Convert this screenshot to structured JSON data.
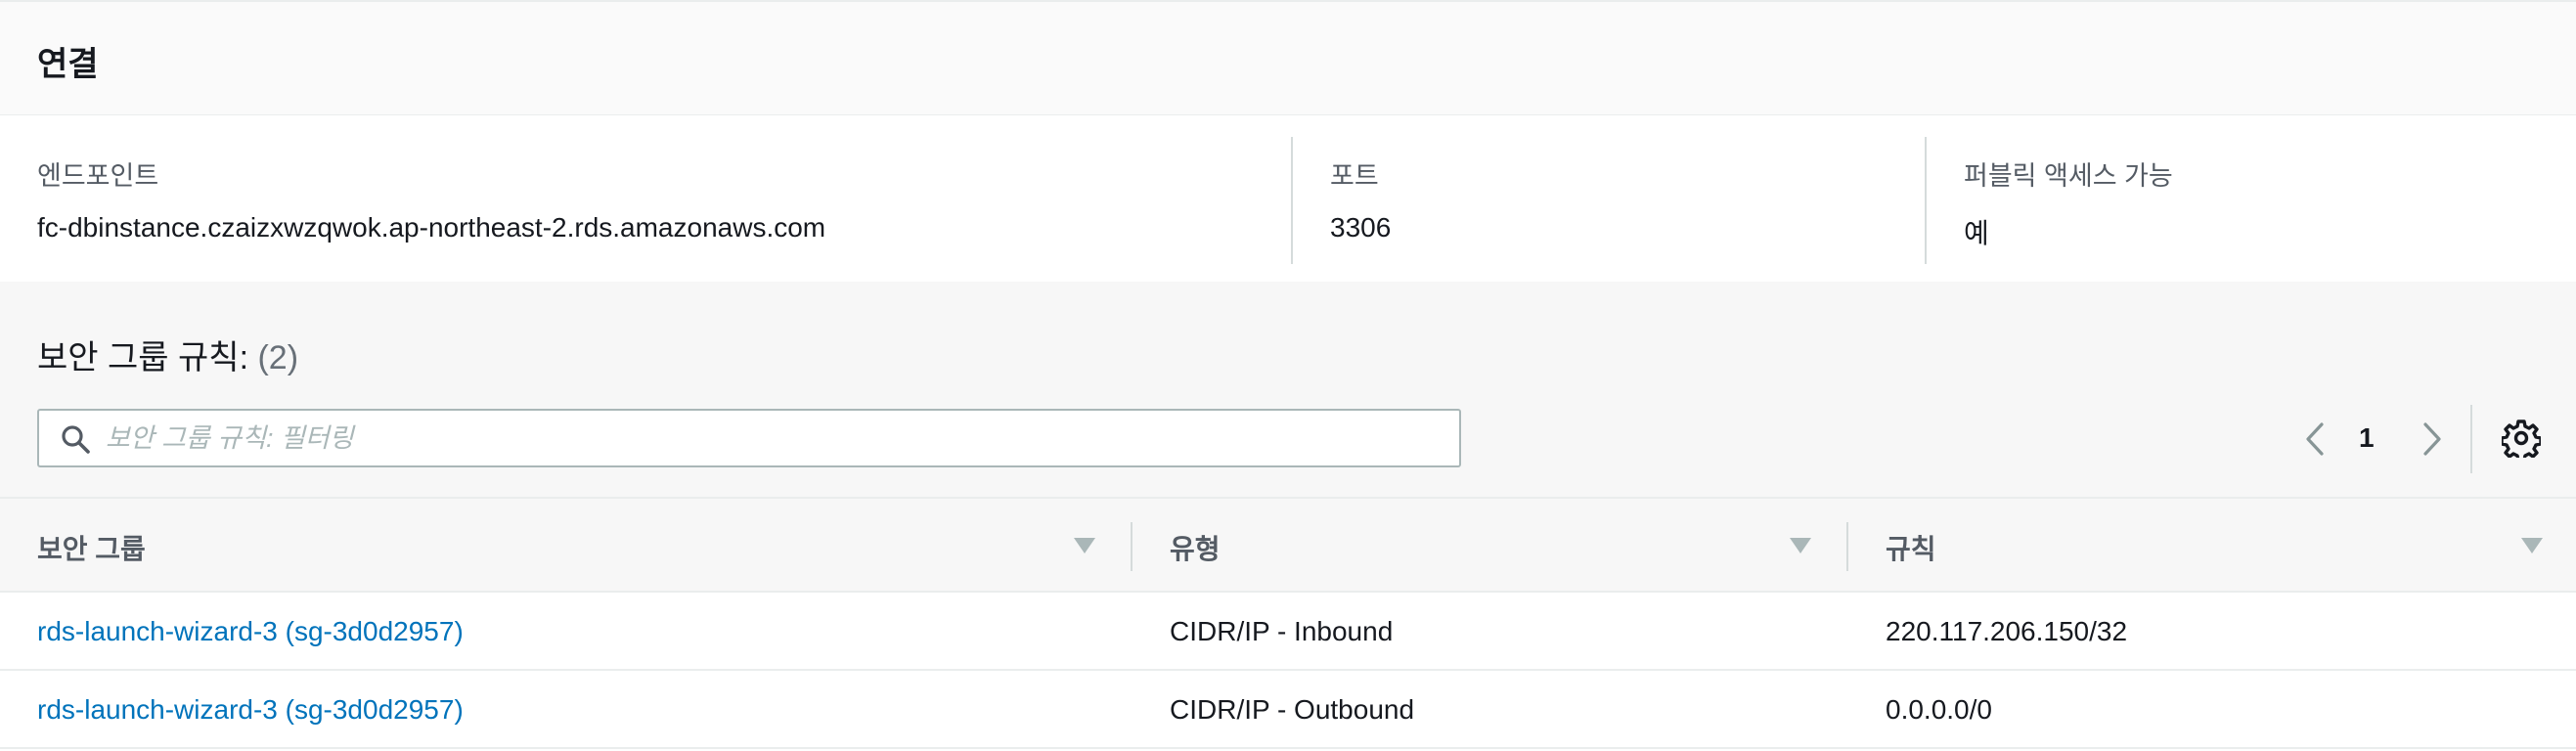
{
  "connection": {
    "title": "연결",
    "endpoint_label": "엔드포인트",
    "endpoint_value": "fc-dbinstance.czaizxwzqwok.ap-northeast-2.rds.amazonaws.com",
    "port_label": "포트",
    "port_value": "3306",
    "public_label": "퍼블릭 액세스 가능",
    "public_value": "예"
  },
  "security_rules": {
    "title": "보안 그룹 규칙:",
    "count": "(2)",
    "search_placeholder": "보안 그룹 규칙: 필터링",
    "search_value": "",
    "page": "1",
    "columns": [
      "보안 그룹",
      "유형",
      "규칙"
    ],
    "rows": [
      {
        "group": "rds-launch-wizard-3 (sg-3d0d2957)",
        "type": "CIDR/IP - Inbound",
        "rule": "220.117.206.150/32"
      },
      {
        "group": "rds-launch-wizard-3 (sg-3d0d2957)",
        "type": "CIDR/IP - Outbound",
        "rule": "0.0.0.0/0"
      }
    ]
  },
  "icons": {
    "search": "search-icon",
    "prev": "chevron-left-icon",
    "next": "chevron-right-icon",
    "settings": "gear-icon",
    "sort": "caret-down-icon"
  },
  "colors": {
    "link": "#0073bb",
    "text": "#16191f",
    "muted": "#545b64",
    "border": "#eaeded"
  }
}
